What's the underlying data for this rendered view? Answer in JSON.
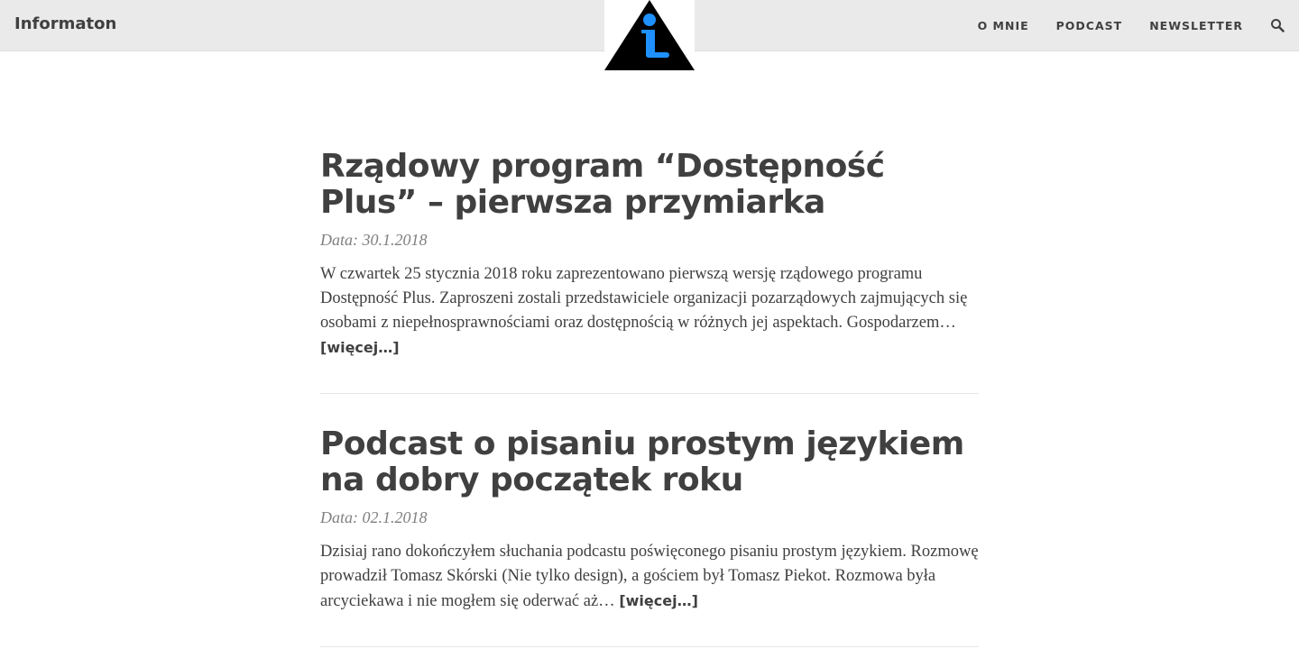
{
  "site": {
    "brand": "Informaton",
    "logo": "info-triangle-logo",
    "accent": "#1e90ff"
  },
  "nav": {
    "items": [
      {
        "label": "O MNIE"
      },
      {
        "label": "PODCAST"
      },
      {
        "label": "NEWSLETTER"
      }
    ],
    "search_icon": "search-icon"
  },
  "posts": [
    {
      "title": "Rządowy program “Dostępność Plus” – pierwsza przymiarka",
      "meta": "Data: 30.1.2018",
      "excerpt": "W czwartek 25 stycznia 2018 roku zaprezentowano pierwszą wersję rządowego programu Dostępność Plus. Zaproszeni zostali przedstawiciele organizacji pozarządowych zajmujących się osobami z niepełnosprawnościami oraz dostępnością w różnych jej aspektach. Gospodarzem…",
      "read_more": "[więcej…]"
    },
    {
      "title": "Podcast o pisaniu prostym językiem na dobry początek roku",
      "meta": "Data: 02.1.2018",
      "excerpt": "Dzisiaj rano dokończyłem słuchania podcastu poświęconego pisaniu prostym językiem. Rozmowę prowadził Tomasz Skórski (Nie tylko design), a gościem był Tomasz Piekot. Rozmowa była arcyciekawa i nie mogłem się oderwać aż…",
      "read_more": "[więcej…]"
    }
  ]
}
